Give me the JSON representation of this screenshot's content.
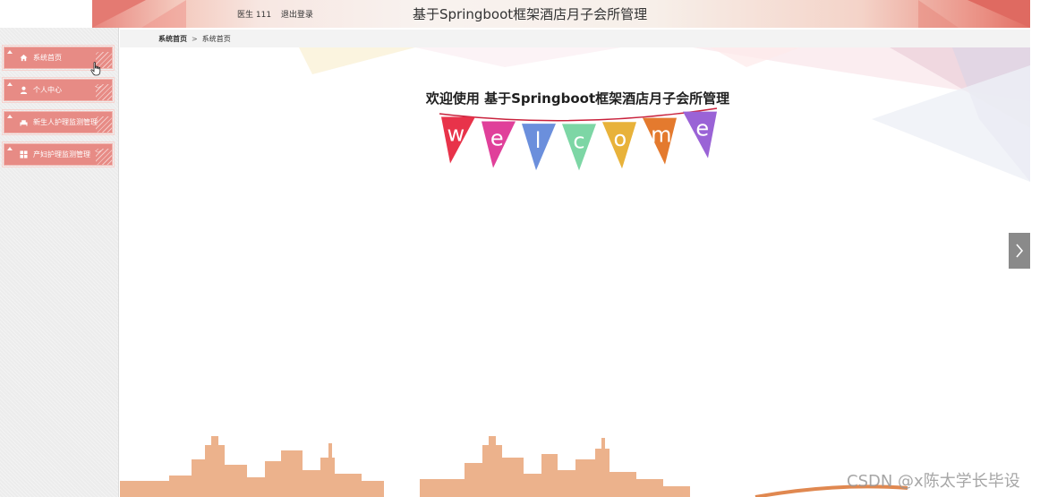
{
  "header": {
    "user_name": "医生 111",
    "logout_label": "退出登录",
    "title": "基于Springboot框架酒店月子会所管理"
  },
  "sidebar": {
    "items": [
      {
        "label": "系统首页",
        "icon": "home-icon"
      },
      {
        "label": "个人中心",
        "icon": "user-icon"
      },
      {
        "label": "新生人护理监测管理",
        "icon": "bed-icon"
      },
      {
        "label": "产妇护理监测管理",
        "icon": "grid-icon"
      }
    ]
  },
  "breadcrumb": {
    "items": [
      "系统首页",
      "系统首页"
    ],
    "separator": ">"
  },
  "main": {
    "welcome_text": "欢迎使用 基于Springboot框架酒店月子会所管理",
    "bunting_letters": [
      "w",
      "e",
      "l",
      "c",
      "o",
      "m",
      "e"
    ],
    "bunting_colors": [
      "#e8334a",
      "#e0409a",
      "#6b8fdc",
      "#7dd6a5",
      "#e8b23a",
      "#e47a2e",
      "#9a63d6"
    ]
  },
  "carousel": {
    "next_icon": "chevron-right-icon"
  },
  "watermark": "CSDN @x陈太学长毕设",
  "colors": {
    "accent": "#e78b85",
    "skyline": "#ecae86"
  }
}
